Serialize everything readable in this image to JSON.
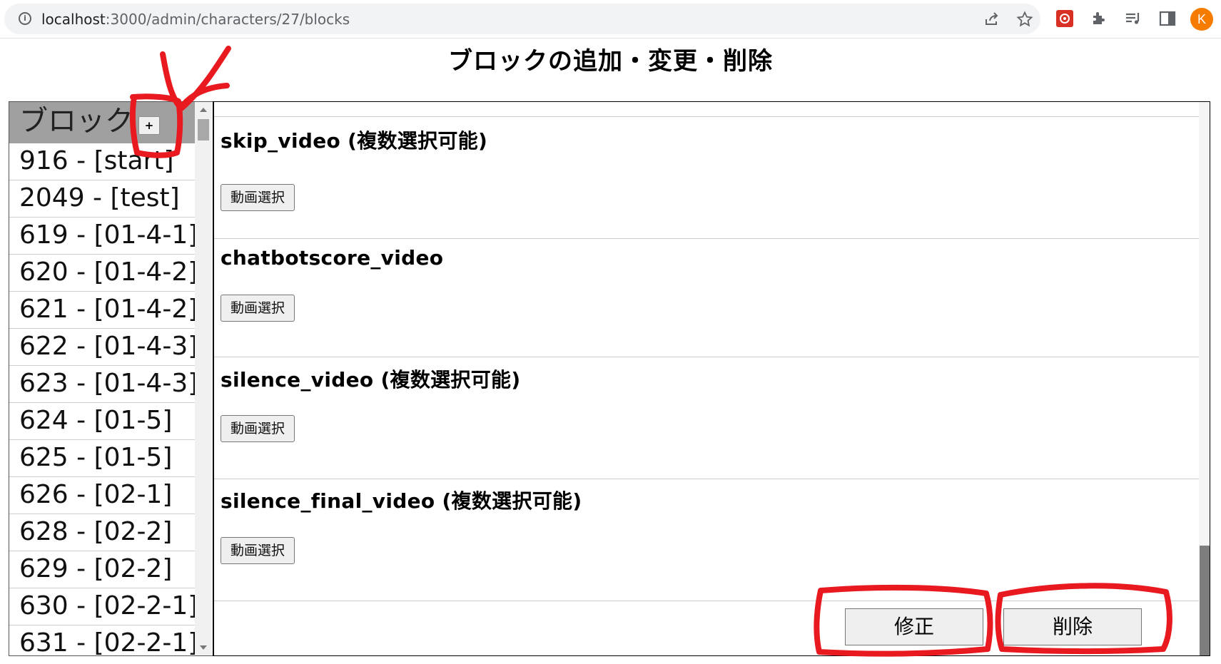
{
  "browser": {
    "url_host": "localhost",
    "url_path": ":3000/admin/characters/27/blocks",
    "avatar_letter": "K",
    "accent_avatar": "#f57c00"
  },
  "page": {
    "title": "ブロックの追加・変更・削除"
  },
  "sidebar": {
    "title": "ブロック",
    "add_label": "+",
    "items": [
      "916 - [start]",
      "2049 - [test]",
      "619 - [01-4-1]",
      "620 - [01-4-2]",
      "621 - [01-4-2]",
      "622 - [01-4-3]",
      "623 - [01-4-3]",
      "624 - [01-5]",
      "625 - [01-5]",
      "626 - [02-1]",
      "628 - [02-2]",
      "629 - [02-2]",
      "630 - [02-2-1]",
      "631 - [02-2-1]"
    ]
  },
  "main": {
    "sections": [
      {
        "title": "skip_video (複数選択可能)",
        "button": "動画選択"
      },
      {
        "title": "chatbotscore_video",
        "button": "動画選択"
      },
      {
        "title": "silence_video (複数選択可能)",
        "button": "動画選択"
      },
      {
        "title": "silence_final_video (複数選択可能)",
        "button": "動画選択"
      }
    ],
    "update_label": "修正",
    "delete_label": "削除"
  },
  "annotation_color": "#e8191f"
}
